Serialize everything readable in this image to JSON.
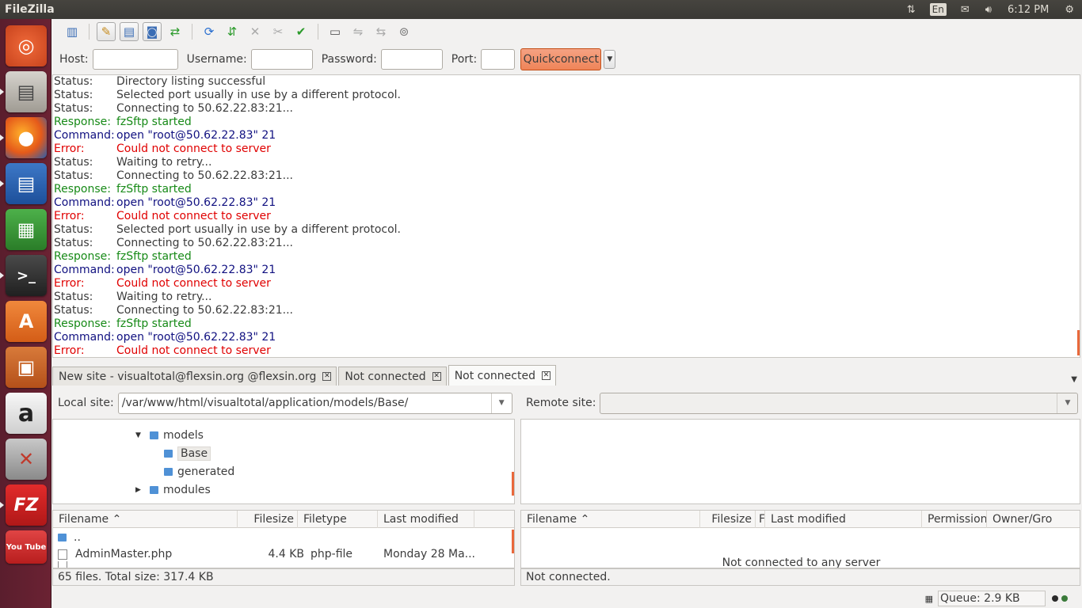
{
  "topbar": {
    "title": "FileZilla",
    "tray": {
      "network_icon": "updown-arrows-icon",
      "lang": "En",
      "mail_icon": "envelope-icon",
      "volume_icon": "speaker-icon",
      "time": "6:12 PM",
      "settings_icon": "gear-icon"
    }
  },
  "launcher": {
    "items": [
      {
        "name": "ubuntu-dash",
        "icon": "ubuntu-logo-icon"
      },
      {
        "name": "files",
        "icon": "file-cabinet-icon"
      },
      {
        "name": "firefox",
        "icon": "firefox-icon"
      },
      {
        "name": "libreoffice-writer",
        "icon": "writer-icon"
      },
      {
        "name": "libreoffice-calc",
        "icon": "calc-icon"
      },
      {
        "name": "terminal",
        "icon": "terminal-icon"
      },
      {
        "name": "software-center",
        "icon": "shopping-bag-icon",
        "glyph": "A"
      },
      {
        "name": "libreoffice-impress",
        "icon": "impress-icon"
      },
      {
        "name": "amazon",
        "icon": "amazon-icon",
        "glyph": "a"
      },
      {
        "name": "system-settings",
        "icon": "wrench-icon"
      },
      {
        "name": "filezilla",
        "icon": "filezilla-icon",
        "glyph": "FZ"
      },
      {
        "name": "youtube",
        "icon": "youtube-icon",
        "glyph": "You Tube"
      }
    ]
  },
  "quickconnect": {
    "host_label": "Host:",
    "host_value": "",
    "username_label": "Username:",
    "username_value": "",
    "password_label": "Password:",
    "password_value": "",
    "port_label": "Port:",
    "port_value": "",
    "button_label": "Quickconnect"
  },
  "log": [
    {
      "type": "status",
      "key": "Status:",
      "text": "Directory listing successful"
    },
    {
      "type": "status",
      "key": "Status:",
      "text": "Selected port usually in use by a different protocol."
    },
    {
      "type": "status",
      "key": "Status:",
      "text": "Connecting to 50.62.22.83:21..."
    },
    {
      "type": "response",
      "key": "Response:",
      "text": "fzSftp started"
    },
    {
      "type": "command",
      "key": "Command:",
      "text": "open \"root@50.62.22.83\" 21"
    },
    {
      "type": "error",
      "key": "Error:",
      "text": "Could not connect to server"
    },
    {
      "type": "status",
      "key": "Status:",
      "text": "Waiting to retry..."
    },
    {
      "type": "status",
      "key": "Status:",
      "text": "Connecting to 50.62.22.83:21..."
    },
    {
      "type": "response",
      "key": "Response:",
      "text": "fzSftp started"
    },
    {
      "type": "command",
      "key": "Command:",
      "text": "open \"root@50.62.22.83\" 21"
    },
    {
      "type": "error",
      "key": "Error:",
      "text": "Could not connect to server"
    },
    {
      "type": "status",
      "key": "Status:",
      "text": "Selected port usually in use by a different protocol."
    },
    {
      "type": "status",
      "key": "Status:",
      "text": "Connecting to 50.62.22.83:21..."
    },
    {
      "type": "response",
      "key": "Response:",
      "text": "fzSftp started"
    },
    {
      "type": "command",
      "key": "Command:",
      "text": "open \"root@50.62.22.83\" 21"
    },
    {
      "type": "error",
      "key": "Error:",
      "text": "Could not connect to server"
    },
    {
      "type": "status",
      "key": "Status:",
      "text": "Waiting to retry..."
    },
    {
      "type": "status",
      "key": "Status:",
      "text": "Connecting to 50.62.22.83:21..."
    },
    {
      "type": "response",
      "key": "Response:",
      "text": "fzSftp started"
    },
    {
      "type": "command",
      "key": "Command:",
      "text": "open \"root@50.62.22.83\" 21"
    },
    {
      "type": "error",
      "key": "Error:",
      "text": "Could not connect to server"
    }
  ],
  "tabs": [
    {
      "label": "New site - visualtotal@flexsin.org @flexsin.org",
      "active": false
    },
    {
      "label": "Not connected",
      "active": false
    },
    {
      "label": "Not connected",
      "active": true
    }
  ],
  "local": {
    "site_label": "Local site:",
    "path": "/var/www/html/visualtotal/application/models/Base/",
    "tree": [
      {
        "label": "models",
        "expanded": true
      },
      {
        "label": "Base",
        "selected": true
      },
      {
        "label": "generated"
      },
      {
        "label": "modules",
        "expanded": false
      }
    ],
    "columns": [
      "Filename",
      "Filesize",
      "Filetype",
      "Last modified"
    ],
    "files": [
      {
        "name": "..",
        "size": "",
        "type": "",
        "modified": ""
      },
      {
        "name": "AdminMaster.php",
        "size": "4.4 KB",
        "type": "php-file",
        "modified": "Monday 28 Ma..."
      }
    ],
    "status": "65 files. Total size: 317.4 KB"
  },
  "remote": {
    "site_label": "Remote site:",
    "path": "",
    "columns": [
      "Filename",
      "Filesize",
      "F",
      "Last modified",
      "Permission",
      "Owner/Gro"
    ],
    "empty_message": "Not connected to any server",
    "status": "Not connected."
  },
  "queue": {
    "label": "Queue: 2.9 KB"
  },
  "colors": {
    "accent": "#ef8458",
    "status": "#3c3c3c",
    "response": "#178a17",
    "command": "#101080",
    "error": "#e00000"
  }
}
